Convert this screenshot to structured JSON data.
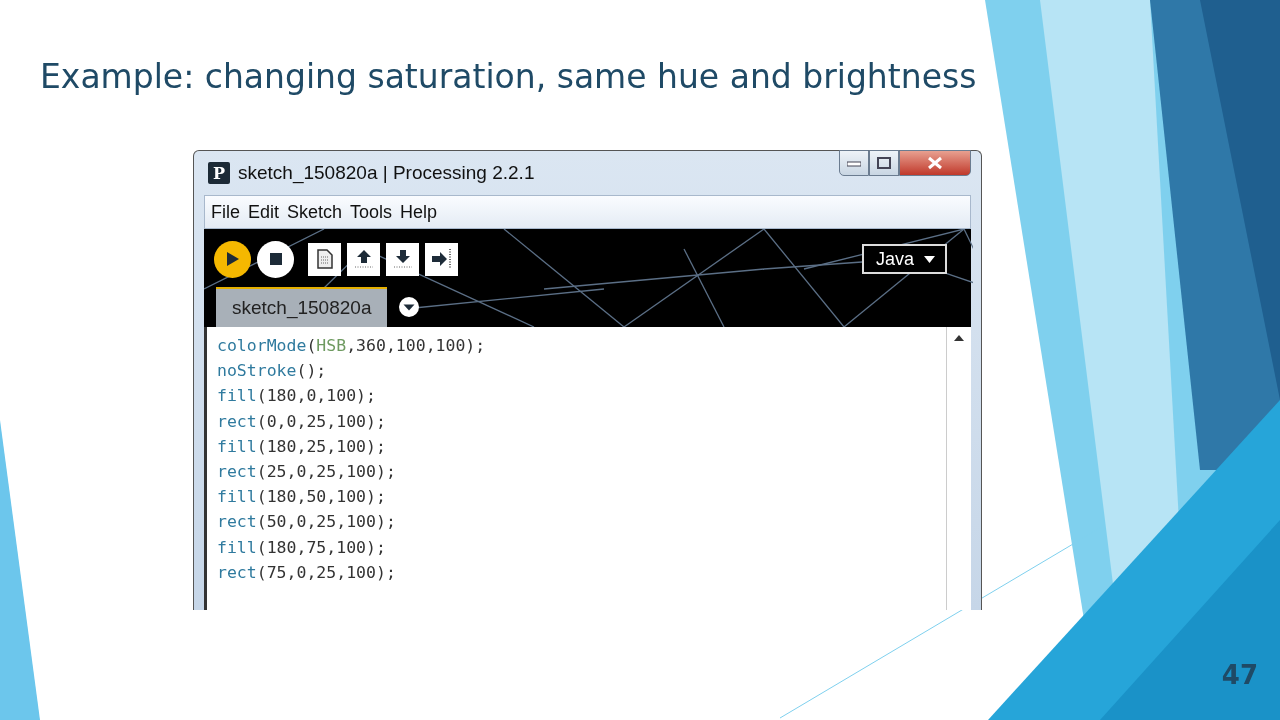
{
  "slide": {
    "title": "Example: changing saturation, same hue and brightness",
    "page_number": "47"
  },
  "window": {
    "icon_letter": "P",
    "title": "sketch_150820a | Processing 2.2.1"
  },
  "menu": [
    "File",
    "Edit",
    "Sketch",
    "Tools",
    "Help"
  ],
  "mode_selector": {
    "label": "Java"
  },
  "tabs": [
    {
      "label": "sketch_150820a",
      "selected": true
    }
  ],
  "code_lines": [
    [
      {
        "kind": "function",
        "text": "colorMode"
      },
      {
        "kind": "plain",
        "text": "("
      },
      {
        "kind": "constant",
        "text": "HSB"
      },
      {
        "kind": "plain",
        "text": ",360,100,100);"
      }
    ],
    [
      {
        "kind": "function",
        "text": "noStroke"
      },
      {
        "kind": "plain",
        "text": "();"
      }
    ],
    [
      {
        "kind": "function",
        "text": "fill"
      },
      {
        "kind": "plain",
        "text": "(180,0,100);"
      }
    ],
    [
      {
        "kind": "function",
        "text": "rect"
      },
      {
        "kind": "plain",
        "text": "(0,0,25,100);"
      }
    ],
    [
      {
        "kind": "function",
        "text": "fill"
      },
      {
        "kind": "plain",
        "text": "(180,25,100);"
      }
    ],
    [
      {
        "kind": "function",
        "text": "rect"
      },
      {
        "kind": "plain",
        "text": "(25,0,25,100);"
      }
    ],
    [
      {
        "kind": "function",
        "text": "fill"
      },
      {
        "kind": "plain",
        "text": "(180,50,100);"
      }
    ],
    [
      {
        "kind": "function",
        "text": "rect"
      },
      {
        "kind": "plain",
        "text": "(50,0,25,100);"
      }
    ],
    [
      {
        "kind": "function",
        "text": "fill"
      },
      {
        "kind": "plain",
        "text": "(180,75,100);"
      }
    ],
    [
      {
        "kind": "function",
        "text": "rect"
      },
      {
        "kind": "plain",
        "text": "(75,0,25,100);"
      }
    ]
  ]
}
